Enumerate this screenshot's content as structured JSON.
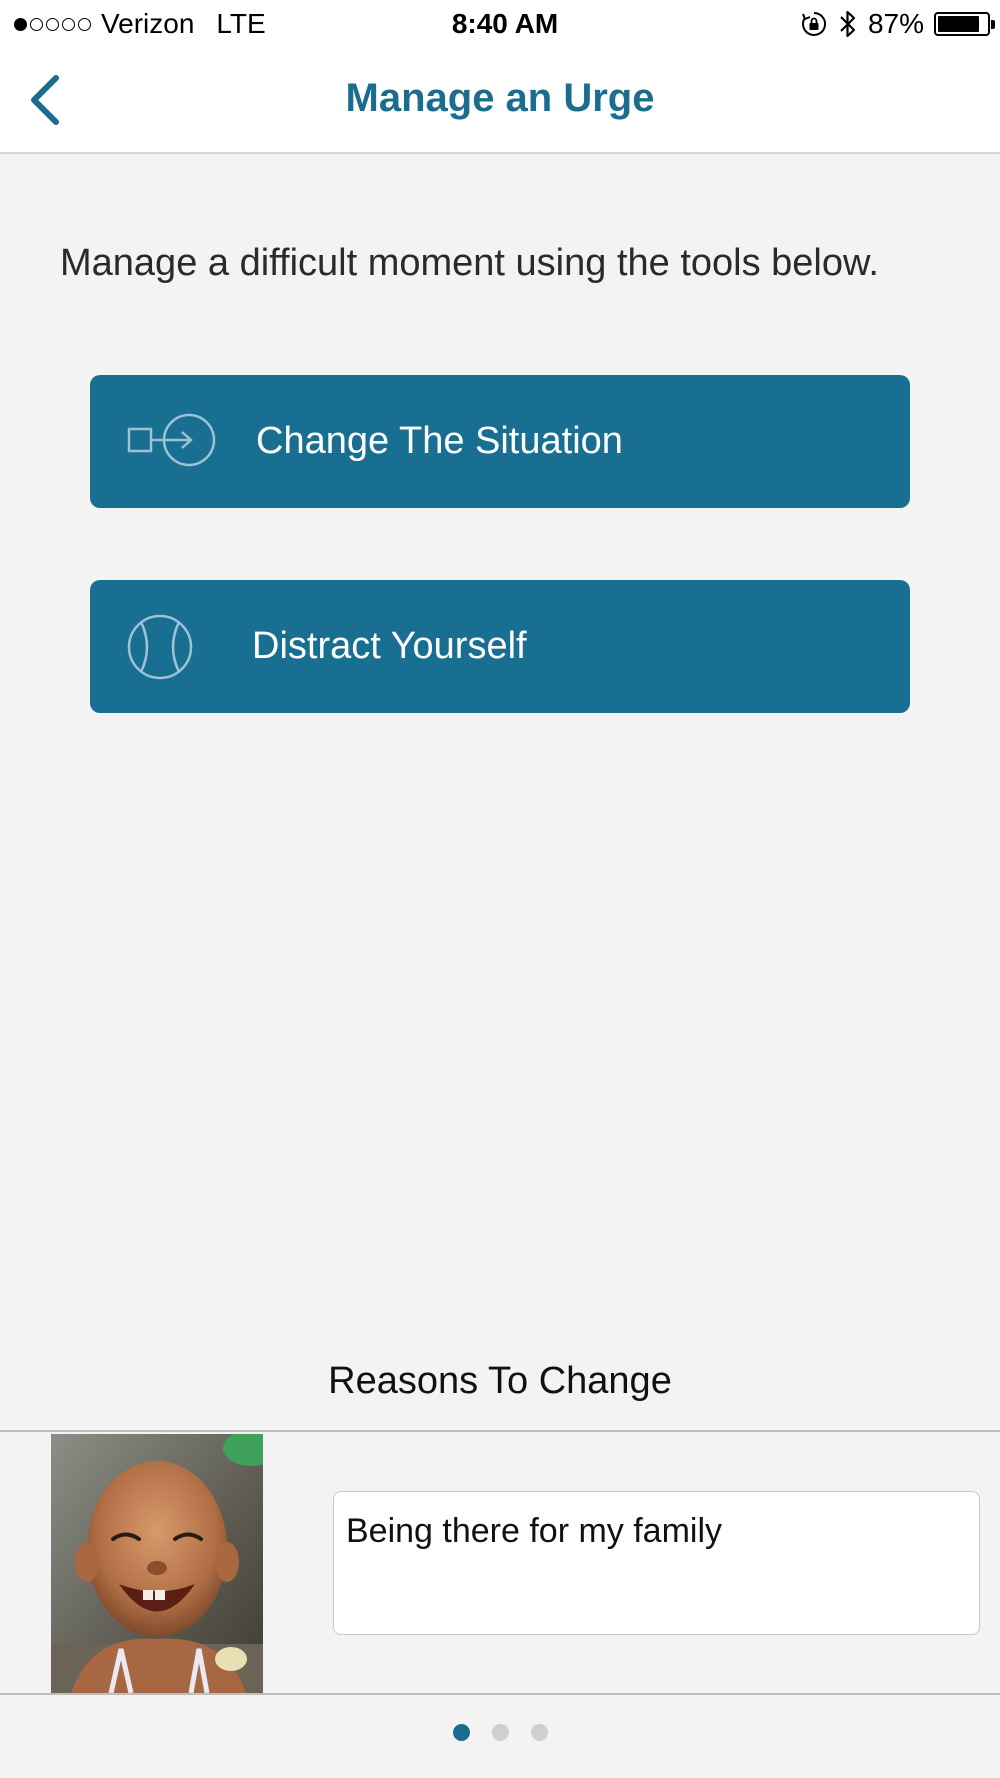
{
  "status_bar": {
    "signal_dots_filled": 1,
    "signal_dots_total": 5,
    "carrier": "Verizon",
    "network": "LTE",
    "time": "8:40 AM",
    "battery_percent": "87%",
    "battery_level": 0.87
  },
  "nav": {
    "title": "Manage an Urge",
    "back_icon": "chevron-left-icon"
  },
  "intro_text": "Manage a difficult moment using the tools below.",
  "tools": [
    {
      "label": "Change The Situation",
      "icon": "square-arrow-circle-icon"
    },
    {
      "label": "Distract Yourself",
      "icon": "tennis-ball-icon"
    }
  ],
  "reasons": {
    "title": "Reasons To Change",
    "current_reason": "Being there for my family",
    "photo": "smiling-child-photo"
  },
  "pager": {
    "count": 3,
    "active_index": 0
  },
  "colors": {
    "accent": "#1b6d8f",
    "button_bg": "#196f92",
    "page_bg": "#f3f3f3"
  }
}
